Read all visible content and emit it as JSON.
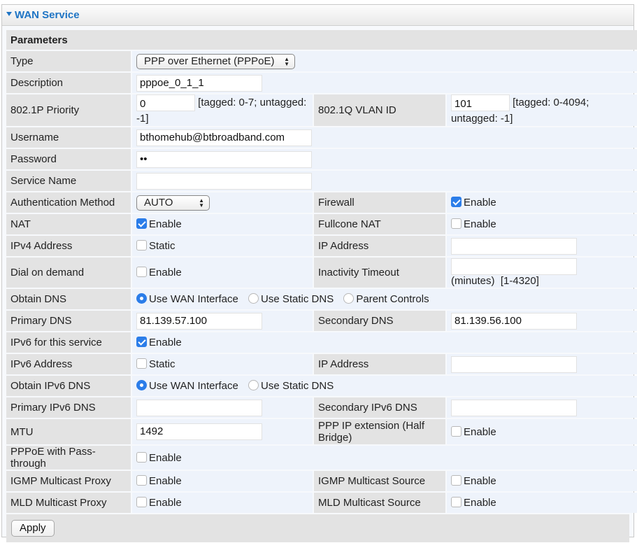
{
  "header": {
    "title": "WAN Service"
  },
  "section_title": "Parameters",
  "type": {
    "label": "Type",
    "value": "PPP over Ethernet (PPPoE)"
  },
  "description": {
    "label": "Description",
    "value": "pppoe_0_1_1"
  },
  "priority": {
    "label": "802.1P Priority",
    "value": "0",
    "hint": "[tagged: 0-7; untagged: -1]"
  },
  "vlan": {
    "label": "802.1Q VLAN ID",
    "value": "101",
    "hint": "[tagged: 0-4094; untagged: -1]"
  },
  "username": {
    "label": "Username",
    "value": "bthomehub@btbroadband.com"
  },
  "password": {
    "label": "Password",
    "value": "••"
  },
  "service_name": {
    "label": "Service Name",
    "value": ""
  },
  "auth": {
    "label": "Authentication Method",
    "value": "AUTO"
  },
  "firewall": {
    "label": "Firewall",
    "option": "Enable",
    "checked": true
  },
  "nat": {
    "label": "NAT",
    "option": "Enable",
    "checked": true
  },
  "fullcone": {
    "label": "Fullcone NAT",
    "option": "Enable",
    "checked": false
  },
  "ipv4": {
    "label": "IPv4 Address",
    "option": "Static",
    "checked": false
  },
  "ipaddr": {
    "label": "IP Address",
    "value": ""
  },
  "dial": {
    "label": "Dial on demand",
    "option": "Enable",
    "checked": false
  },
  "inactivity": {
    "label": "Inactivity Timeout",
    "value": "",
    "hint": "(minutes)  [1-4320]"
  },
  "obtain_dns": {
    "label": "Obtain DNS",
    "options": [
      "Use WAN Interface",
      "Use Static DNS",
      "Parent Controls"
    ],
    "selected": 0
  },
  "primary_dns": {
    "label": "Primary DNS",
    "value": "81.139.57.100"
  },
  "secondary_dns": {
    "label": "Secondary DNS",
    "value": "81.139.56.100"
  },
  "ipv6_service": {
    "label": "IPv6 for this service",
    "option": "Enable",
    "checked": true
  },
  "ipv6_addr": {
    "label": "IPv6 Address",
    "option": "Static",
    "checked": false
  },
  "ipv6_ipaddr": {
    "label": "IP Address",
    "value": ""
  },
  "obtain_ipv6_dns": {
    "label": "Obtain IPv6 DNS",
    "options": [
      "Use WAN Interface",
      "Use Static DNS"
    ],
    "selected": 0
  },
  "primary_ipv6_dns": {
    "label": "Primary IPv6 DNS",
    "value": ""
  },
  "secondary_ipv6_dns": {
    "label": "Secondary IPv6 DNS",
    "value": ""
  },
  "mtu": {
    "label": "MTU",
    "value": "1492"
  },
  "ppp_ext": {
    "label": "PPP IP extension (Half Bridge)",
    "option": "Enable",
    "checked": false
  },
  "pppoe_pass": {
    "label": "PPPoE with Pass-through",
    "option": "Enable",
    "checked": false
  },
  "igmp_proxy": {
    "label": "IGMP Multicast Proxy",
    "option": "Enable",
    "checked": false
  },
  "igmp_source": {
    "label": "IGMP Multicast Source",
    "option": "Enable",
    "checked": false
  },
  "mld_proxy": {
    "label": "MLD Multicast Proxy",
    "option": "Enable",
    "checked": false
  },
  "mld_source": {
    "label": "MLD Multicast Source",
    "option": "Enable",
    "checked": false
  },
  "apply_label": "Apply",
  "colors": {
    "header_text": "#1e74c4",
    "label_bg": "#e3e3e3",
    "value_bg": "#eef3fb",
    "accent": "#2b7de9"
  }
}
